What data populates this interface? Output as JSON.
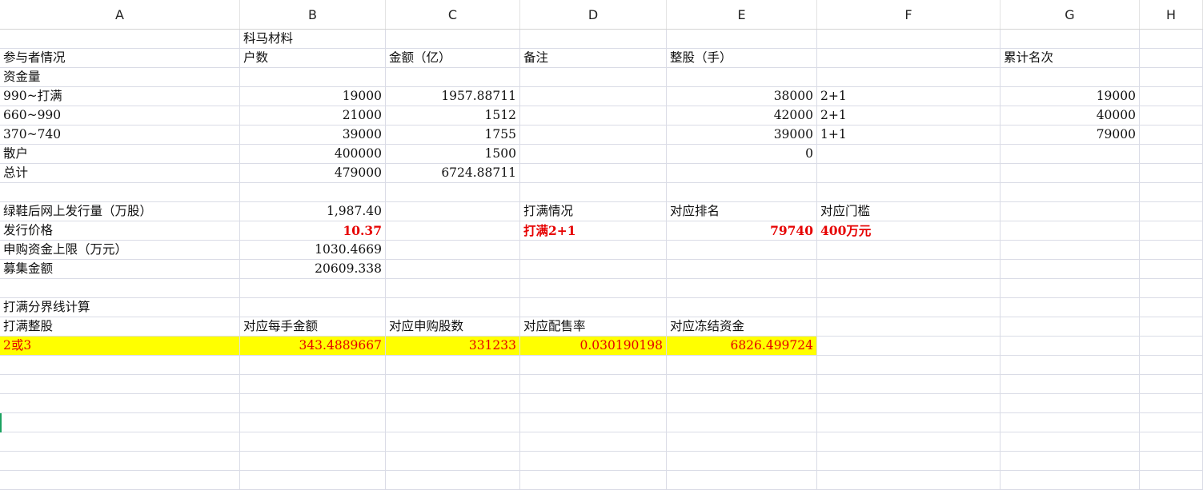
{
  "columns": [
    "A",
    "B",
    "C",
    "D",
    "E",
    "F",
    "G",
    "H"
  ],
  "rows": [
    [
      "",
      "科马材料",
      "",
      "",
      "",
      "",
      "",
      ""
    ],
    [
      "参与者情况",
      "户数",
      "金额（亿）",
      "备注",
      "整股（手）",
      "",
      "累计名次",
      ""
    ],
    [
      "资金量",
      "",
      "",
      "",
      "",
      "",
      "",
      ""
    ],
    [
      "990~打满",
      "19000",
      "1957.88711",
      "",
      "38000",
      "2+1",
      "19000",
      ""
    ],
    [
      "660~990",
      "21000",
      "1512",
      "",
      "42000",
      "2+1",
      "40000",
      ""
    ],
    [
      "370~740",
      "39000",
      "1755",
      "",
      "39000",
      "1+1",
      "79000",
      ""
    ],
    [
      "散户",
      "400000",
      "1500",
      "",
      "0",
      "",
      "",
      ""
    ],
    [
      "总计",
      "479000",
      "6724.88711",
      "",
      "",
      "",
      "",
      ""
    ],
    [
      "",
      "",
      "",
      "",
      "",
      "",
      "",
      ""
    ],
    [
      "绿鞋后网上发行量（万股）",
      "1,987.40",
      "",
      "打满情况",
      "对应排名",
      "对应门槛",
      "",
      ""
    ],
    [
      "发行价格",
      "10.37",
      "",
      "打满2+1",
      "79740",
      "400万元",
      "",
      ""
    ],
    [
      "申购资金上限（万元）",
      "1030.4669",
      "",
      "",
      "",
      "",
      "",
      ""
    ],
    [
      "募集金额",
      "20609.338",
      "",
      "",
      "",
      "",
      "",
      ""
    ],
    [
      "",
      "",
      "",
      "",
      "",
      "",
      "",
      ""
    ],
    [
      "打满分界线计算",
      "",
      "",
      "",
      "",
      "",
      "",
      ""
    ],
    [
      "打满整股",
      "对应每手金额",
      "对应申购股数",
      "对应配售率",
      "对应冻结资金",
      "",
      "",
      ""
    ],
    [
      "2或3",
      "343.4889667",
      "331233",
      "0.030190198",
      "6826.499724",
      "",
      "",
      ""
    ],
    [
      "",
      "",
      "",
      "",
      "",
      "",
      "",
      ""
    ],
    [
      "",
      "",
      "",
      "",
      "",
      "",
      "",
      ""
    ],
    [
      "",
      "",
      "",
      "",
      "",
      "",
      "",
      ""
    ],
    [
      "",
      "",
      "",
      "",
      "",
      "",
      "",
      ""
    ],
    [
      "",
      "",
      "",
      "",
      "",
      "",
      "",
      ""
    ],
    [
      "",
      "",
      "",
      "",
      "",
      "",
      "",
      ""
    ],
    [
      "",
      "",
      "",
      "",
      "",
      "",
      "",
      ""
    ]
  ],
  "colors": {
    "red": "#e60000",
    "highlight": "#ffff00",
    "grid": "#dadce6"
  }
}
